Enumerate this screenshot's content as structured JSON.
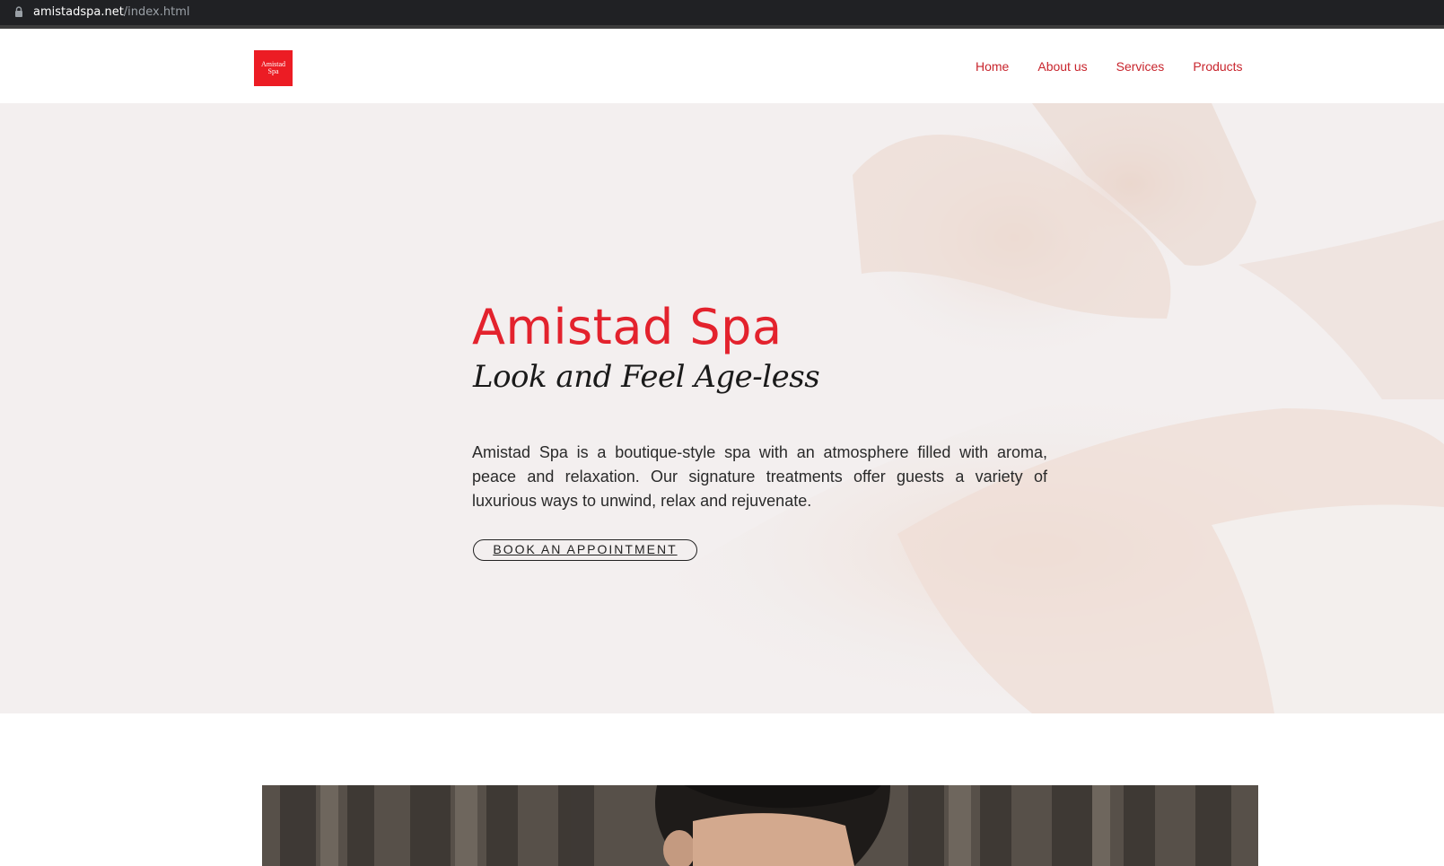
{
  "browser": {
    "url_host": "amistadspa.net",
    "url_path": "/index.html",
    "lock_icon": "lock-icon"
  },
  "header": {
    "logo_line1": "Amistad",
    "logo_line2": "Spa",
    "nav": [
      "Home",
      "About us",
      "Services",
      "Products"
    ]
  },
  "hero": {
    "title": "Amistad Spa",
    "tagline": "Look and Feel Age-less",
    "description": "Amistad Spa is a boutique-style spa with an atmosphere filled with aroma, peace and relaxation. Our signature  treatments offer guests a variety of luxurious ways to  unwind, relax and rejuvenate.",
    "cta": "BOOK AN APPOINTMENT"
  },
  "colors": {
    "brand_red": "#ec1c24",
    "nav_text": "#c8252d",
    "hero_bg": "#f2eeee"
  }
}
